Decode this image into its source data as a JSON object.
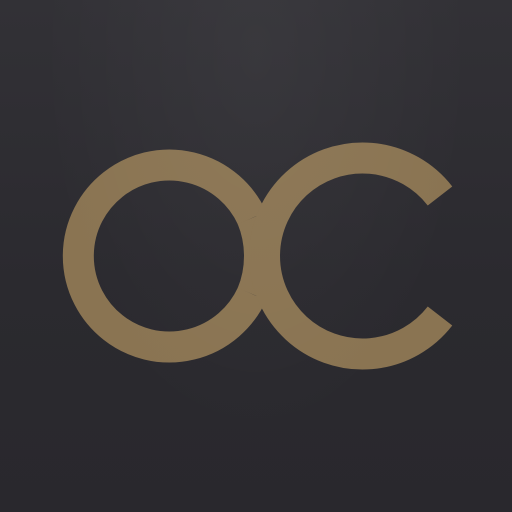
{
  "app_icon": {
    "logo_icon": "infinity-oc-logo-icon",
    "colors": {
      "background": "#2d2c31",
      "logo_gold": "#8a7452"
    }
  }
}
